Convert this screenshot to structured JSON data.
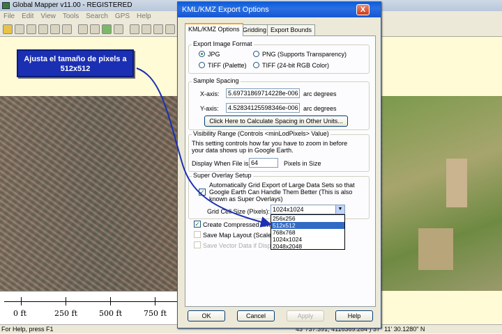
{
  "app": {
    "title": "Global Mapper v11.00 - REGISTERED",
    "menu": [
      "File",
      "Edit",
      "View",
      "Tools",
      "Search",
      "GPS",
      "Help"
    ]
  },
  "callout": {
    "line1": "Ajusta el tamaño de pixels a",
    "line2": "512x512"
  },
  "scale": {
    "labels": [
      "0 ft",
      "250 ft",
      "500 ft",
      "750 ft"
    ]
  },
  "status": {
    "help": "For Help, press F1",
    "coords": "43°737.391, 4116369.284 ) 37° 11' 30.1280\" N"
  },
  "dialog": {
    "title": "KML/KMZ Export Options",
    "close": "X",
    "tabs": [
      "KML/KMZ Options",
      "Gridding",
      "Export Bounds"
    ],
    "image_format": {
      "title": "Export Image Format",
      "jpg": "JPG",
      "png": "PNG (Supports Transparency)",
      "tiff_palette": "TIFF (Palette)",
      "tiff_rgb": "TIFF (24-bit RGB Color)"
    },
    "sample_spacing": {
      "title": "Sample Spacing",
      "x_label": "X-axis:",
      "x_value": "5.69731869714228e-006",
      "y_label": "Y-axis:",
      "y_value": "4.52834125598346e-006",
      "unit": "arc degrees",
      "calc_button": "Click Here to Calculate Spacing in Other Units..."
    },
    "visibility": {
      "title": "Visibility Range (Controls <minLodPixels> Value)",
      "desc1": "This setting controls how far you have to zoom in before",
      "desc2": "your data shows up in Google Earth.",
      "display_label": "Display When File is",
      "value": "64",
      "unit": "Pixels in Size"
    },
    "super_overlay": {
      "title": "Super Overlay Setup",
      "line1": "Automatically Grid Export of Large Data Sets so that",
      "line2": "Google Earth Can Handle Them Better (This is also",
      "line3": "known as Super Overlays)",
      "grid_label": "Grid Cell Size (Pixels):",
      "selected": "1024x1024",
      "options": [
        "256x256",
        "512x512",
        "768x768",
        "1024x1024",
        "2048x2048"
      ]
    },
    "create_compressed": "Create Compressed KMZ F",
    "save_layout": "Save Map Layout (Scale/M",
    "save_vector": "Save Vector Data if Displa",
    "buttons": {
      "ok": "OK",
      "cancel": "Cancel",
      "apply": "Apply",
      "help": "Help"
    }
  }
}
